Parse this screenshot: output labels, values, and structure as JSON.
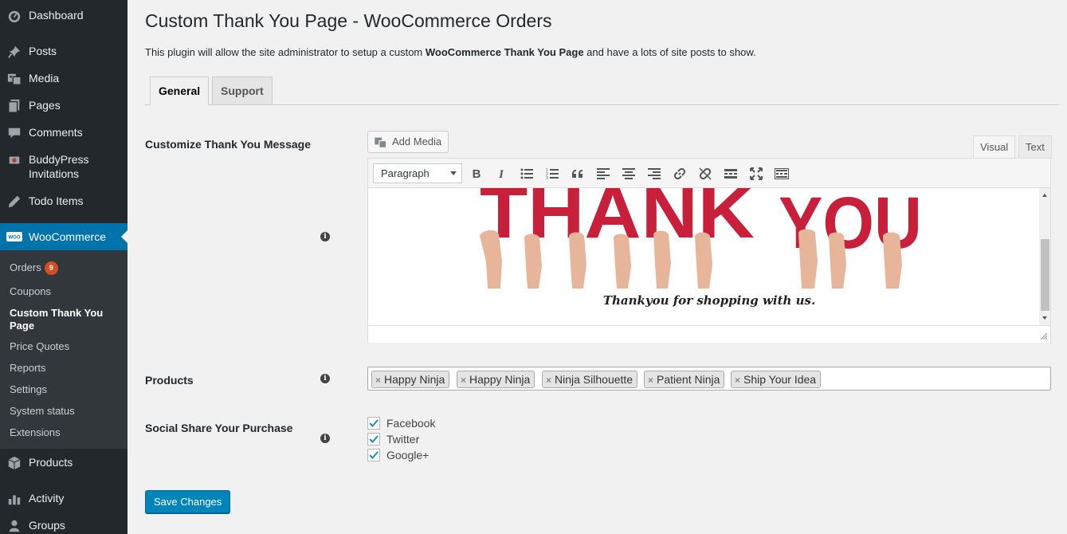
{
  "sidebar": {
    "items": [
      {
        "label": "Dashboard",
        "icon": "dashboard-icon"
      },
      {
        "label": "Posts",
        "icon": "pin-icon"
      },
      {
        "label": "Media",
        "icon": "media-icon"
      },
      {
        "label": "Pages",
        "icon": "pages-icon"
      },
      {
        "label": "Comments",
        "icon": "comments-icon"
      },
      {
        "label": "BuddyPress Invitations",
        "icon": "buddypress-icon"
      },
      {
        "label": "Todo Items",
        "icon": "pencil-icon"
      },
      {
        "label": "WooCommerce",
        "icon": "woocommerce-icon"
      },
      {
        "label": "Products",
        "icon": "products-icon"
      },
      {
        "label": "Activity",
        "icon": "activity-icon"
      },
      {
        "label": "Groups",
        "icon": "groups-icon"
      }
    ],
    "woo_logo_text": "WOO",
    "submenu": [
      {
        "label": "Orders",
        "badge": "9"
      },
      {
        "label": "Coupons"
      },
      {
        "label": "Custom Thank You Page"
      },
      {
        "label": "Price Quotes"
      },
      {
        "label": "Reports"
      },
      {
        "label": "Settings"
      },
      {
        "label": "System status"
      },
      {
        "label": "Extensions"
      }
    ]
  },
  "page": {
    "title": "Custom Thank You Page - WooCommerce Orders",
    "intro_before": "This plugin will allow the site administrator to setup a custom ",
    "intro_bold": "WooCommerce Thank You Page",
    "intro_after": " and have a lots of site posts to show."
  },
  "tabs": [
    {
      "label": "General",
      "active": true
    },
    {
      "label": "Support",
      "active": false
    }
  ],
  "message_section": {
    "label": "Customize Thank You Message",
    "add_media_label": "Add Media",
    "editor_tabs": [
      "Visual",
      "Text"
    ],
    "format_select": "Paragraph",
    "toolbar_buttons": [
      "bold-icon",
      "italic-icon",
      "bullet-list-icon",
      "numbered-list-icon",
      "blockquote-icon",
      "align-left-icon",
      "align-center-icon",
      "align-right-icon",
      "link-icon",
      "unlink-icon",
      "read-more-icon",
      "fullscreen-icon",
      "toolbar-toggle-icon"
    ],
    "image_word_1": "THANK",
    "image_word_2": "YOU",
    "caption": "Thankyou for shopping with us."
  },
  "products_section": {
    "label": "Products",
    "selected": [
      "Happy Ninja",
      "Happy Ninja",
      "Ninja Silhouette",
      "Patient Ninja",
      "Ship Your Idea"
    ],
    "remove_symbol": "×"
  },
  "social_section": {
    "label": "Social Share Your Purchase",
    "options": [
      {
        "label": "Facebook",
        "checked": true
      },
      {
        "label": "Twitter",
        "checked": true
      },
      {
        "label": "Google+",
        "checked": true
      }
    ]
  },
  "save_label": "Save Changes",
  "info_symbol": "i",
  "colors": {
    "sidebar_bg": "#23282d",
    "active_menu": "#0073aa",
    "primary_button": "#0085ba",
    "badge": "#d54e21",
    "thank_you_red": "#c8203a"
  }
}
